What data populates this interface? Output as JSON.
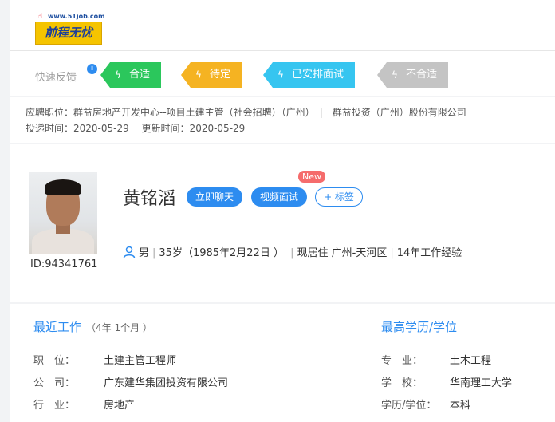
{
  "logo": {
    "url": "www.51job.com",
    "text": "前程无忧"
  },
  "feedback": {
    "label": "快速反馈",
    "info": "i",
    "buttons": [
      {
        "label": "合适",
        "color": "#2bc75c"
      },
      {
        "label": "待定",
        "color": "#f5b322"
      },
      {
        "label": "已安排面试",
        "color": "#36c5f0"
      },
      {
        "label": "不合适",
        "color": "#c4c4c4"
      }
    ]
  },
  "application": {
    "position_line": "应聘职位：群益房地产开发中心--项目土建主管（社会招聘）（广州）　|　群益投资（广州）股份有限公司",
    "time_line": "投递时间：2020-05-29　 更新时间：2020-05-29"
  },
  "candidate": {
    "name": "黄铭滔",
    "id": "ID:94341761",
    "chat_button": "立即聊天",
    "video_button": "视频面试",
    "new_badge": "New",
    "tag_button": "+ 标签",
    "gender": "男",
    "age": "35岁（1985年2月22日 ）",
    "residence": "现居住 广州-天河区",
    "experience": "14年工作经验"
  },
  "recent_work": {
    "title": "最近工作",
    "duration": "（4年 1个月 ）",
    "rows": [
      {
        "label": "职　位：",
        "value": "土建主管工程师"
      },
      {
        "label": "公　司：",
        "value": "广东建华集团投资有限公司"
      },
      {
        "label": "行　业：",
        "value": "房地产"
      }
    ]
  },
  "education": {
    "title": "最高学历/学位",
    "rows": [
      {
        "label": "专　业：",
        "value": "土木工程"
      },
      {
        "label": "学　校：",
        "value": "华南理工大学"
      },
      {
        "label": "学历/学位：",
        "value": "本科"
      }
    ]
  }
}
